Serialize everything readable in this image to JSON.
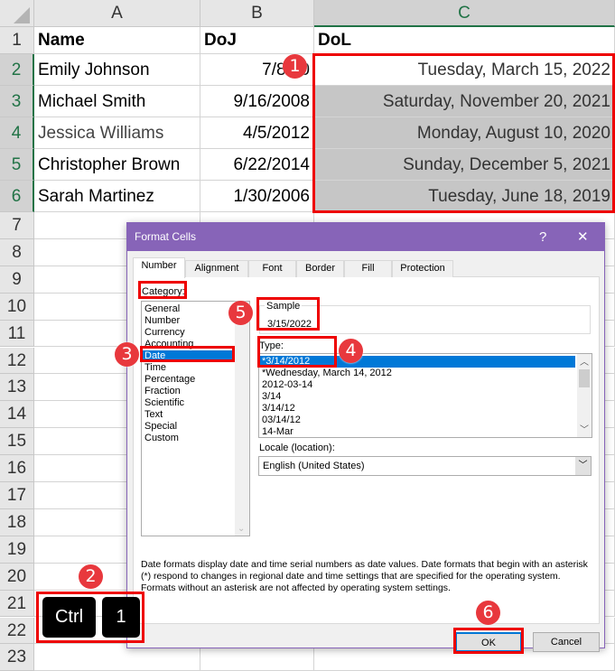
{
  "spreadsheet": {
    "columns": [
      "A",
      "B",
      "C"
    ],
    "rows": [
      "1",
      "2",
      "3",
      "4",
      "5",
      "6",
      "7",
      "8",
      "9",
      "10",
      "11",
      "12",
      "13",
      "14",
      "15",
      "16",
      "17",
      "18",
      "19",
      "20",
      "21",
      "22",
      "23"
    ],
    "headers": [
      "Name",
      "DoJ",
      "DoL"
    ],
    "data": [
      [
        "Emily Johnson",
        "7/8/20",
        "Tuesday, March 15, 2022"
      ],
      [
        "Michael Smith",
        "9/16/2008",
        "Saturday, November 20, 2021"
      ],
      [
        "Jessica Williams",
        "4/5/2012",
        "Monday, August 10, 2020"
      ],
      [
        "Christopher Brown",
        "6/22/2014",
        "Sunday, December 5, 2021"
      ],
      [
        "Sarah Martinez",
        "1/30/2006",
        "Tuesday, June 18, 2019"
      ]
    ]
  },
  "dialog": {
    "title": "Format Cells",
    "help": "?",
    "close": "✕",
    "tabs": [
      "Number",
      "Alignment",
      "Font",
      "Border",
      "Fill",
      "Protection"
    ],
    "category_label": "Category:",
    "categories": [
      "General",
      "Number",
      "Currency",
      "Accounting",
      "Date",
      "Time",
      "Percentage",
      "Fraction",
      "Scientific",
      "Text",
      "Special",
      "Custom"
    ],
    "selected_category": "Date",
    "sample_label": "Sample",
    "sample_value": "3/15/2022",
    "type_label": "Type:",
    "types": [
      "*3/14/2012",
      "*Wednesday, March 14, 2012",
      "2012-03-14",
      "3/14",
      "3/14/12",
      "03/14/12",
      "14-Mar"
    ],
    "selected_type": "*3/14/2012",
    "locale_label": "Locale (location):",
    "locale_value": "English (United States)",
    "description": "Date formats display date and time serial numbers as date values.  Date formats that begin with an asterisk (*) respond to changes in regional date and time settings that are specified for the operating system. Formats without an asterisk are not affected by operating system settings.",
    "ok": "OK",
    "cancel": "Cancel"
  },
  "shortcut": {
    "keys": [
      "Ctrl",
      "1"
    ]
  },
  "callouts": [
    "1",
    "2",
    "3",
    "4",
    "5",
    "6"
  ],
  "colors": {
    "titlebar": "#8764b8",
    "highlight": "#e00000",
    "selection": "#0078d7",
    "callout": "#e8383d"
  }
}
